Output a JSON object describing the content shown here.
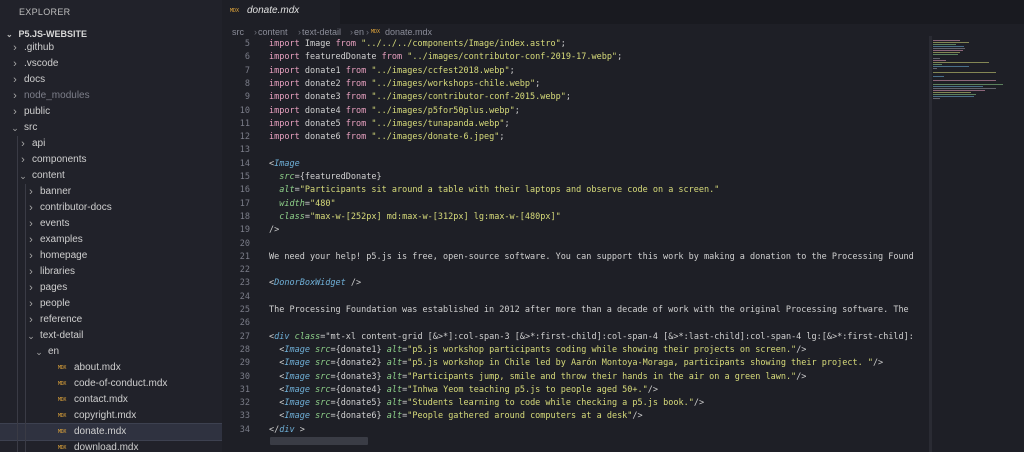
{
  "explorer": {
    "title": "EXPLORER",
    "project": "P5.JS-WEBSITE",
    "items": [
      {
        "label": ".github",
        "icon": "chevron-right-icon"
      },
      {
        "label": ".vscode",
        "icon": "chevron-right-icon"
      },
      {
        "label": "docs",
        "icon": "chevron-right-icon"
      },
      {
        "label": "node_modules",
        "icon": "chevron-right-icon"
      },
      {
        "label": "public",
        "icon": "chevron-right-icon"
      },
      {
        "label": "src",
        "icon": "chevron-down-icon"
      },
      {
        "label": "api",
        "icon": "chevron-right-icon"
      },
      {
        "label": "components",
        "icon": "chevron-right-icon"
      },
      {
        "label": "content",
        "icon": "chevron-down-icon"
      },
      {
        "label": "banner",
        "icon": "chevron-right-icon"
      },
      {
        "label": "contributor-docs",
        "icon": "chevron-right-icon"
      },
      {
        "label": "events",
        "icon": "chevron-right-icon"
      },
      {
        "label": "examples",
        "icon": "chevron-right-icon"
      },
      {
        "label": "homepage",
        "icon": "chevron-right-icon"
      },
      {
        "label": "libraries",
        "icon": "chevron-right-icon"
      },
      {
        "label": "pages",
        "icon": "chevron-right-icon"
      },
      {
        "label": "people",
        "icon": "chevron-right-icon"
      },
      {
        "label": "reference",
        "icon": "chevron-right-icon"
      },
      {
        "label": "text-detail",
        "icon": "chevron-down-icon"
      },
      {
        "label": "en",
        "icon": "chevron-down-icon"
      },
      {
        "label": "about.mdx",
        "icon": "mdx-file-icon"
      },
      {
        "label": "code-of-conduct.mdx",
        "icon": "mdx-file-icon"
      },
      {
        "label": "contact.mdx",
        "icon": "mdx-file-icon"
      },
      {
        "label": "copyright.mdx",
        "icon": "mdx-file-icon"
      },
      {
        "label": "donate.mdx",
        "icon": "mdx-file-icon"
      },
      {
        "label": "download.mdx",
        "icon": "mdx-file-icon"
      }
    ]
  },
  "editor": {
    "tab": {
      "label": "donate.mdx",
      "icon_text": "MDX"
    },
    "breadcrumb": [
      "src",
      "content",
      "text-detail",
      "en",
      "donate.mdx"
    ],
    "lines": [
      {
        "n": "5",
        "text": "import Image from \"../../../components/Image/index.astro\";"
      },
      {
        "n": "6",
        "text": "import featuredDonate from \"../images/contributor-conf-2019-17.webp\";"
      },
      {
        "n": "7",
        "text": "import donate1 from \"../images/ccfest2018.webp\";"
      },
      {
        "n": "8",
        "text": "import donate2 from \"../images/workshops-chile.webp\";"
      },
      {
        "n": "9",
        "text": "import donate3 from \"../images/contributor-conf-2015.webp\";"
      },
      {
        "n": "10",
        "text": "import donate4 from \"../images/p5for50plus.webp\";"
      },
      {
        "n": "11",
        "text": "import donate5 from \"../images/tunapanda.webp\";"
      },
      {
        "n": "12",
        "text": "import donate6 from \"../images/donate-6.jpeg\";"
      },
      {
        "n": "13",
        "text": ""
      },
      {
        "n": "14",
        "text": "<Image"
      },
      {
        "n": "15",
        "text": "  src={featuredDonate}"
      },
      {
        "n": "16",
        "text": "  alt=\"Participants sit around a table with their laptops and observe code on a screen.\""
      },
      {
        "n": "17",
        "text": "  width=\"480\""
      },
      {
        "n": "18",
        "text": "  class=\"max-w-[252px] md:max-w-[312px] lg:max-w-[480px]\""
      },
      {
        "n": "19",
        "text": "/>"
      },
      {
        "n": "20",
        "text": ""
      },
      {
        "n": "21",
        "text": "We need your help! p5.js is free, open-source software. You can support this work by making a donation to the Processing Found"
      },
      {
        "n": "22",
        "text": ""
      },
      {
        "n": "23",
        "text": "<DonorBoxWidget />"
      },
      {
        "n": "24",
        "text": ""
      },
      {
        "n": "25",
        "text": "The Processing Foundation was established in 2012 after more than a decade of work with the original Processing software. The"
      },
      {
        "n": "26",
        "text": ""
      },
      {
        "n": "27",
        "text": "<div class=\"mt-xl content-grid [&>*]:col-span-3 [&>*:first-child]:col-span-4 [&>*:last-child]:col-span-4 lg:[&>*:first-child]:"
      },
      {
        "n": "28",
        "text": "  <Image src={donate1} alt=\"p5.js workshop participants coding while showing their projects on screen.\"/>"
      },
      {
        "n": "29",
        "text": "  <Image src={donate2} alt=\"p5.js workshop in Chile led by Aarón Montoya-Moraga, participants showing their project. \"/>"
      },
      {
        "n": "30",
        "text": "  <Image src={donate3} alt=\"Participants jump, smile and throw their hands in the air on a green lawn.\"/>"
      },
      {
        "n": "31",
        "text": "  <Image src={donate4} alt=\"Inhwa Yeom teaching p5.js to people aged 50+.\"/>"
      },
      {
        "n": "32",
        "text": "  <Image src={donate5} alt=\"Students learning to code while checking a p5.js book.\"/>"
      },
      {
        "n": "33",
        "text": "  <Image src={donate6} alt=\"People gathered around computers at a desk\"/>"
      },
      {
        "n": "34",
        "text": "</div >"
      }
    ]
  },
  "colors": {
    "keyword": "#e8a0bf",
    "string": "#d7db7a",
    "tag": "#6fb0d8",
    "attribute": "#8fd18a",
    "mdx_icon": "#e0a53a"
  }
}
